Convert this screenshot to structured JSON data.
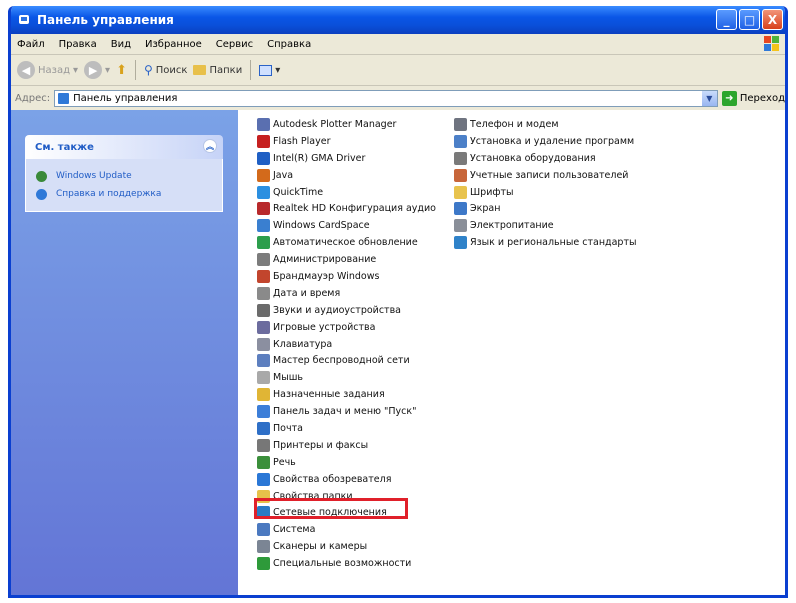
{
  "window": {
    "title": "Панель управления",
    "buttons": {
      "minimize": "_",
      "maximize": "□",
      "close": "X"
    }
  },
  "menu": [
    "Файл",
    "Правка",
    "Вид",
    "Избранное",
    "Сервис",
    "Справка"
  ],
  "toolbar": {
    "back": "Назад",
    "search": "Поиск",
    "folders": "Папки"
  },
  "address": {
    "label": "Адрес:",
    "value": "Панель управления",
    "go": "Переход"
  },
  "see_also": {
    "title": "См. также",
    "items": [
      {
        "label": "Windows Update",
        "icon": "windows-update-icon"
      },
      {
        "label": "Справка и поддержка",
        "icon": "help-support-icon"
      }
    ]
  },
  "items_col1": [
    {
      "label": "Autodesk Plotter Manager",
      "icon": "plotter-icon",
      "color": "#5a6fb0"
    },
    {
      "label": "Flash Player",
      "icon": "flash-icon",
      "color": "#c62020"
    },
    {
      "label": "Intel(R) GMA Driver",
      "icon": "intel-icon",
      "color": "#1f5fc4"
    },
    {
      "label": "Java",
      "icon": "java-icon",
      "color": "#d36a1b"
    },
    {
      "label": "QuickTime",
      "icon": "quicktime-icon",
      "color": "#2b8fe0"
    },
    {
      "label": "Realtek HD Конфигурация аудио",
      "icon": "audio-icon",
      "color": "#b8292b"
    },
    {
      "label": "Windows CardSpace",
      "icon": "cardspace-icon",
      "color": "#3a7fd0"
    },
    {
      "label": "Автоматическое обновление",
      "icon": "auto-update-icon",
      "color": "#2c9e4c"
    },
    {
      "label": "Администрирование",
      "icon": "admin-tools-icon",
      "color": "#7c7c7c"
    },
    {
      "label": "Брандмауэр Windows",
      "icon": "firewall-icon",
      "color": "#c2452d"
    },
    {
      "label": "Дата и время",
      "icon": "clock-icon",
      "color": "#8a8a8a"
    },
    {
      "label": "Звуки и аудиоустройства",
      "icon": "speaker-icon",
      "color": "#6b6b6b"
    },
    {
      "label": "Игровые устройства",
      "icon": "gamepad-icon",
      "color": "#6c6c9e"
    },
    {
      "label": "Клавиатура",
      "icon": "keyboard-icon",
      "color": "#8b8fa0"
    },
    {
      "label": "Мастер беспроводной сети",
      "icon": "wireless-icon",
      "color": "#5d7fbf"
    },
    {
      "label": "Мышь",
      "icon": "mouse-icon",
      "color": "#a9a9a9"
    },
    {
      "label": "Назначенные задания",
      "icon": "tasks-icon",
      "color": "#e0b535"
    },
    {
      "label": "Панель задач и меню \"Пуск\"",
      "icon": "taskbar-icon",
      "color": "#3c7ed8"
    },
    {
      "label": "Почта",
      "icon": "mail-icon",
      "color": "#2e6fc7"
    },
    {
      "label": "Принтеры и факсы",
      "icon": "printer-icon",
      "color": "#777777"
    },
    {
      "label": "Речь",
      "icon": "speech-icon",
      "color": "#3b8f3b"
    },
    {
      "label": "Свойства обозревателя",
      "icon": "internet-options-icon",
      "color": "#2a77d6"
    },
    {
      "label": "Свойства папки",
      "icon": "folder-options-icon",
      "color": "#e6c24a"
    },
    {
      "label": "Сетевые подключения",
      "icon": "network-connections-icon",
      "color": "#2a7bc4"
    },
    {
      "label": "Система",
      "icon": "system-icon",
      "color": "#4b79c0"
    },
    {
      "label": "Сканеры и камеры",
      "icon": "scanner-icon",
      "color": "#7b8594"
    },
    {
      "label": "Специальные возможности",
      "icon": "accessibility-icon",
      "color": "#2e9a3a"
    }
  ],
  "items_col2": [
    {
      "label": "Телефон и модем",
      "icon": "phone-icon",
      "color": "#6f7480"
    },
    {
      "label": "Установка и удаление программ",
      "icon": "add-remove-icon",
      "color": "#4c80c8"
    },
    {
      "label": "Установка оборудования",
      "icon": "hardware-icon",
      "color": "#7a7a7a"
    },
    {
      "label": "Учетные записи пользователей",
      "icon": "users-icon",
      "color": "#c8663a"
    },
    {
      "label": "Шрифты",
      "icon": "fonts-icon",
      "color": "#e8c34d"
    },
    {
      "label": "Экран",
      "icon": "display-icon",
      "color": "#3d78c8"
    },
    {
      "label": "Электропитание",
      "icon": "power-icon",
      "color": "#8a8f99"
    },
    {
      "label": "Язык и региональные стандарты",
      "icon": "globe-icon",
      "color": "#2f82c9"
    }
  ],
  "highlight_color": "#e0202a"
}
